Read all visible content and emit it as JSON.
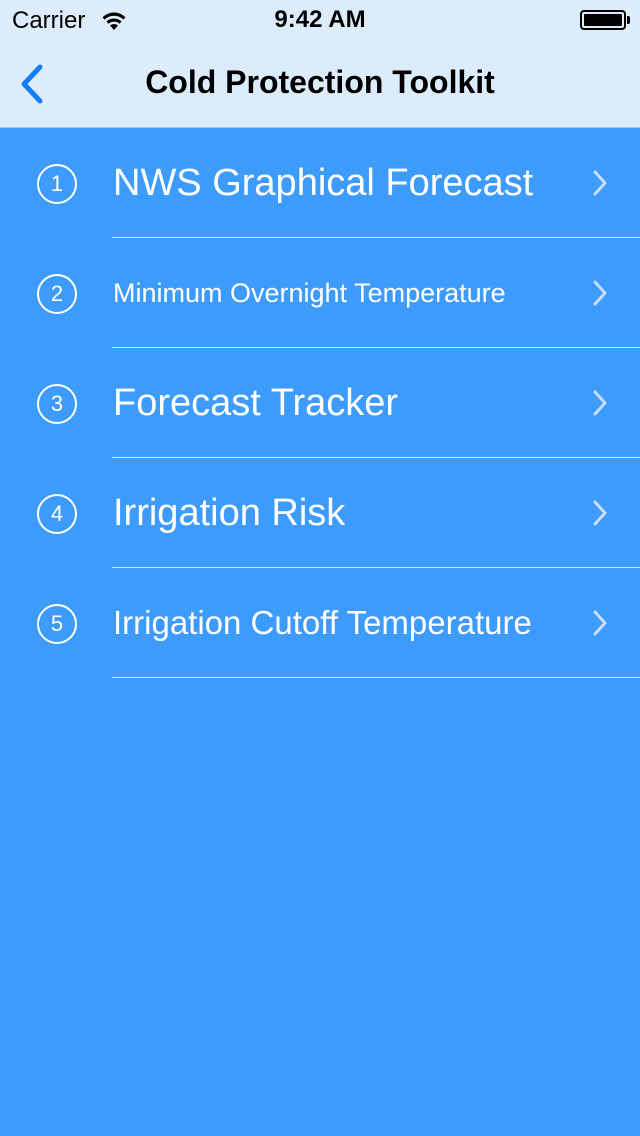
{
  "status": {
    "carrier": "Carrier",
    "time": "9:42 AM"
  },
  "nav": {
    "title": "Cold Protection Toolkit",
    "back_icon": "chevron-left-icon"
  },
  "colors": {
    "background": "#3d9bfc",
    "navbar": "#dcecfb",
    "accent": "#157efb"
  },
  "menu": {
    "items": [
      {
        "number": "1",
        "label": "NWS Graphical Forecast"
      },
      {
        "number": "2",
        "label": "Minimum Overnight Temperature"
      },
      {
        "number": "3",
        "label": "Forecast Tracker"
      },
      {
        "number": "4",
        "label": "Irrigation Risk"
      },
      {
        "number": "5",
        "label": "Irrigation Cutoff Temperature"
      }
    ]
  }
}
